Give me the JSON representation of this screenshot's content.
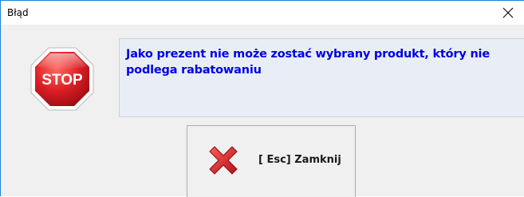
{
  "window": {
    "title": "Błąd",
    "close_symbol": "✕"
  },
  "icons": {
    "stop": "stop-sign-icon",
    "close_button": "red-x-icon"
  },
  "stop_sign": {
    "text": "STOP"
  },
  "message": {
    "text": "Jako prezent nie może zostać wybrany produkt, który nie podlega rabatowaniu"
  },
  "close_button": {
    "label": "[ Esc] Zamknij"
  },
  "colors": {
    "message_text": "#0000e6",
    "stop_red": "#d9242a",
    "x_red": "#e0242b"
  }
}
